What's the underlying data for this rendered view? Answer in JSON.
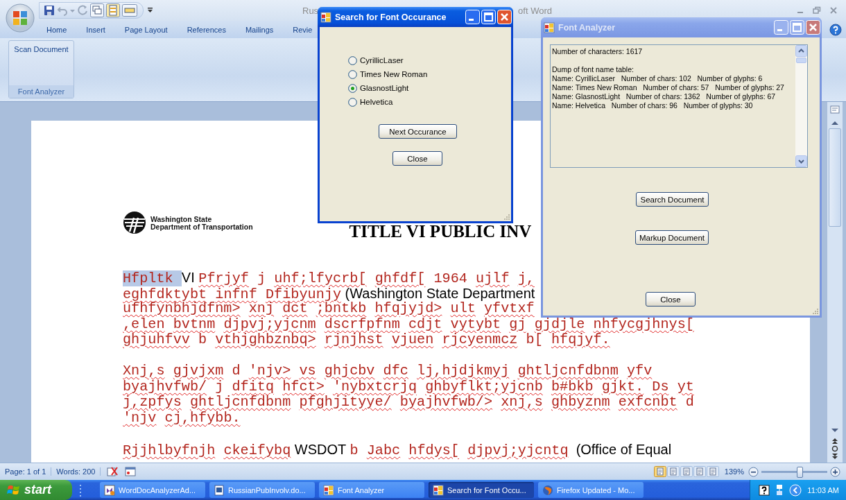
{
  "word_window": {
    "title_start": "Rus",
    "title_end": "oft Word",
    "tabs": [
      {
        "label": "Home",
        "selected": false
      },
      {
        "label": "Insert",
        "selected": false
      },
      {
        "label": "Page Layout",
        "selected": false
      },
      {
        "label": "References",
        "selected": false
      },
      {
        "label": "Mailings",
        "selected": false
      },
      {
        "label": "Revie",
        "selected": false
      }
    ],
    "ribbon": {
      "buttons": [
        "Scan Document"
      ],
      "group": "Font Analyzer"
    }
  },
  "document": {
    "letterhead": [
      "Washington State",
      "Department of Transportation"
    ],
    "heading": "TITLE VI PUBLIC INV",
    "paragraphs": [
      [
        [
          {
            "kind": "selected",
            "text": "Hfpltk "
          },
          {
            "kind": "sans",
            "text": "VI "
          },
          {
            "kind": "misspelled",
            "text": "Pfrjyf"
          },
          {
            "kind": "plain",
            "text": " j "
          },
          {
            "kind": "misspelled",
            "text": "uhf;lfycrb[ ghfdf["
          },
          {
            "kind": "plain",
            "text": " 1964 "
          },
          {
            "kind": "misspelled",
            "text": "ujlf j,"
          }
        ],
        [
          {
            "kind": "misspelled",
            "text": "eghfdktybt infnf Dfibyunjy"
          },
          {
            "kind": "sans",
            "text": " (Washington State Department"
          }
        ],
        [
          {
            "kind": "misspelled",
            "text": "ufhfynbhjdfnm> xnj dct ;bntkb hfqjyjd> ult yfvtxf"
          }
        ],
        [
          {
            "kind": "misspelled",
            "text": ",elen bvtnm djpvj;yjcnm dscrfpfnm cdjt vytybt gj gjdjle nhfycgjhnys["
          }
        ],
        [
          {
            "kind": "misspelled",
            "text": "ghjuhfvv"
          },
          {
            "kind": "plain",
            "text": " b "
          },
          {
            "kind": "misspelled",
            "text": "vthjghbznbq> rjnjhst vjuen rjcyenmcz"
          },
          {
            "kind": "plain",
            "text": " b[ "
          },
          {
            "kind": "misspelled",
            "text": "hfqjyf."
          }
        ]
      ],
      [
        [
          {
            "kind": "misspelled",
            "text": "Xnj,s gjvjxm"
          },
          {
            "kind": "plain",
            "text": " d "
          },
          {
            "kind": "misspelled",
            "text": "'njv> vs ghjcbv dfc lj,hjdjkmyj ghtljcnfdbnm yfv"
          }
        ],
        [
          {
            "kind": "misspelled",
            "text": "byajhvfwb/"
          },
          {
            "kind": "plain",
            "text": " j "
          },
          {
            "kind": "misspelled",
            "text": "dfitq hfct> 'nybxtcrjq ghbyflkt;yjcnb b#bkb gjkt. Ds yt"
          }
        ],
        [
          {
            "kind": "misspelled",
            "text": "j,zpfys ghtljcnfdbnm pfghjityye/ byajhvfwb/> xnj,s ghbyznm exfcnbt"
          },
          {
            "kind": "plain",
            "text": " d"
          }
        ],
        [
          {
            "kind": "misspelled",
            "text": "'njv cj,hfybb."
          }
        ]
      ],
      [
        [
          {
            "kind": "misspelled",
            "text": "Rjjhlbyfnjh ckeifybq"
          },
          {
            "kind": "sans",
            "text": " WSDOT "
          },
          {
            "kind": "plain",
            "text": "b "
          },
          {
            "kind": "misspelled",
            "text": "Jabc hfdys[ djpvj;yjcntq"
          },
          {
            "kind": "sans",
            "text": "  (Office of Equal"
          }
        ]
      ]
    ]
  },
  "status_bar": {
    "page": "Page: 1 of 1",
    "words": "Words: 200",
    "zoom": "139%",
    "zoom_slider": {
      "level": 0.58
    }
  },
  "search_dialog": {
    "title": "Search for Font Occurance",
    "active": true,
    "options": [
      {
        "label": "CyrillicLaser",
        "selected": false
      },
      {
        "label": "Times New Roman",
        "selected": false
      },
      {
        "label": "GlasnostLight",
        "selected": true
      },
      {
        "label": "Helvetica",
        "selected": false
      }
    ],
    "buttons": [
      "Next Occurance",
      "Close"
    ]
  },
  "font_analyzer": {
    "title": "Font Analyzer",
    "active": false,
    "output": [
      [
        "Number of characters: 1617"
      ],
      [
        "Dump of font name table:",
        "Name: CyrillicLaser   Number of chars: 102   Number of glyphs: 6",
        "Name: Times New Roman   Number of chars: 57   Number of glyphs: 27",
        "Name: GlasnostLight   Number of chars: 1362   Number of glyphs: 67",
        "Name: Helvetica   Number of chars: 96   Number of glyphs: 30"
      ]
    ],
    "buttons": [
      "Search Document",
      "Markup Document",
      "Close"
    ]
  },
  "taskbar": {
    "start": "start",
    "items": [
      {
        "label": "WordDocAnalyzerAd...",
        "kind": "studio",
        "selected": false
      },
      {
        "label": "RussianPubInvolv.do...",
        "kind": "word",
        "selected": false
      },
      {
        "label": "Font Analyzer",
        "kind": "form",
        "selected": false
      },
      {
        "label": "Search for Font Occu...",
        "kind": "form",
        "selected": true
      },
      {
        "label": "Firefox Updated - Mo...",
        "kind": "globe",
        "selected": false
      }
    ],
    "clock": "11:03 AM"
  }
}
